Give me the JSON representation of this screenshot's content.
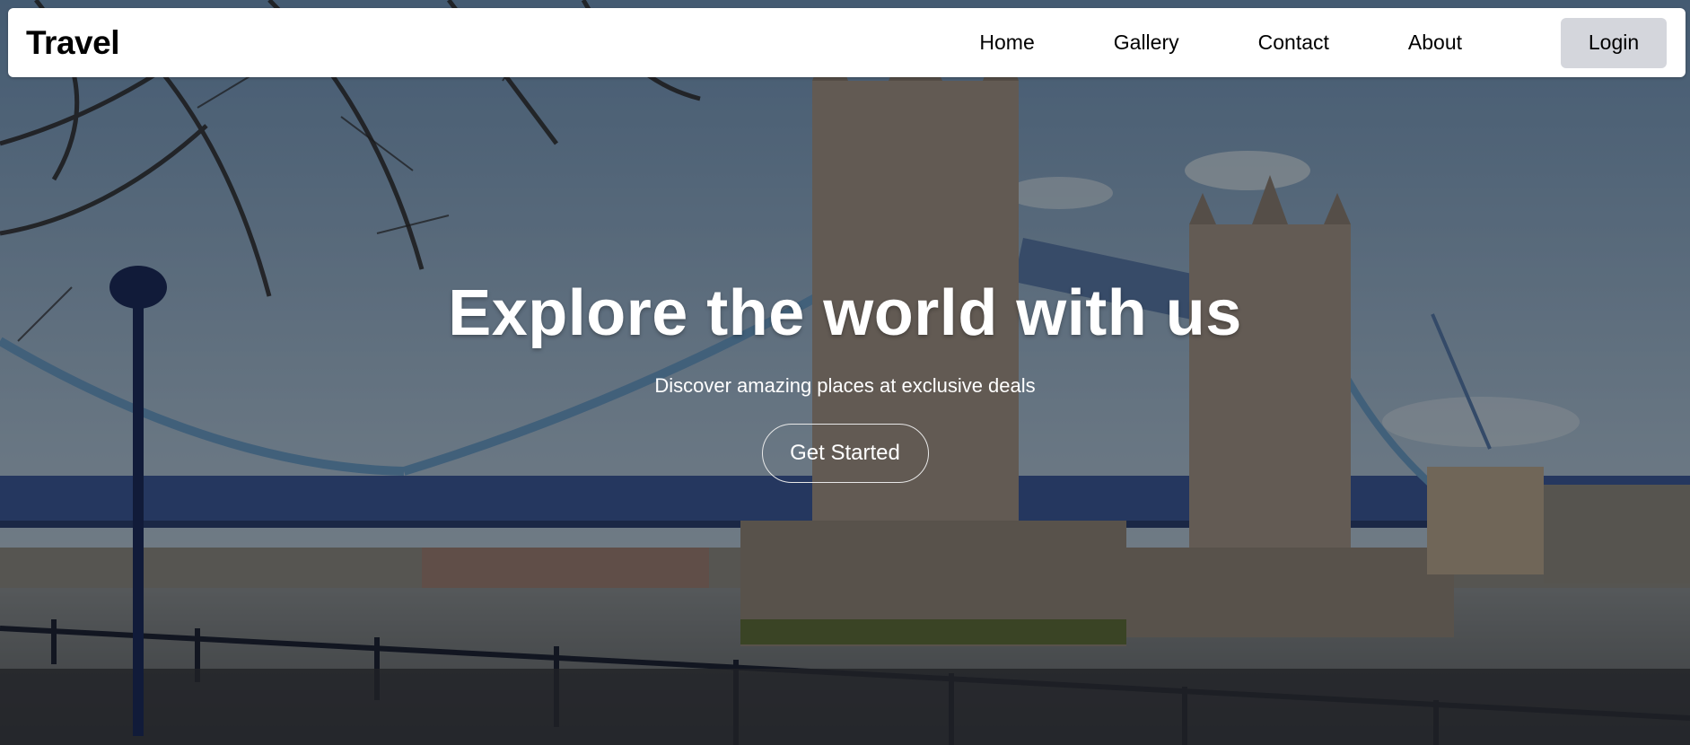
{
  "navbar": {
    "brand": "Travel",
    "links": [
      {
        "label": "Home"
      },
      {
        "label": "Gallery"
      },
      {
        "label": "Contact"
      },
      {
        "label": "About"
      }
    ],
    "login_label": "Login"
  },
  "hero": {
    "title": "Explore the world with us",
    "subtitle": "Discover amazing places at exclusive deals",
    "cta_label": "Get Started",
    "background": "tower-bridge-photo"
  },
  "colors": {
    "navbar_bg": "#ffffff",
    "login_bg": "#d4d6dc",
    "hero_text": "#ffffff"
  }
}
